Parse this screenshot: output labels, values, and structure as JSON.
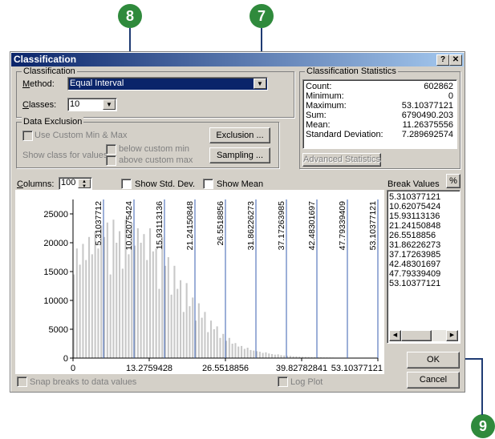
{
  "callouts": {
    "c7": "7",
    "c8": "8",
    "c9": "9"
  },
  "title": "Classification",
  "title_buttons": {
    "help": "?",
    "close": "✕"
  },
  "classification_group": {
    "label": "Classification",
    "method_label": "Method:",
    "method_value": "Equal Interval",
    "classes_label": "Classes:",
    "classes_value": "10"
  },
  "data_exclusion": {
    "label": "Data Exclusion",
    "use_custom": "Use Custom Min & Max",
    "show_class_for": "Show class for values",
    "below_custom_min": "below custom min",
    "above_custom_max": "above custom max",
    "exclusion_button": "Exclusion ...",
    "sampling_button": "Sampling ..."
  },
  "statistics": {
    "label": "Classification Statistics",
    "rows": [
      {
        "name": "Count:",
        "value": "602862"
      },
      {
        "name": "Minimum:",
        "value": "0"
      },
      {
        "name": "Maximum:",
        "value": "53.10377121"
      },
      {
        "name": "Sum:",
        "value": "6790490.203"
      },
      {
        "name": "Mean:",
        "value": "11.26375556"
      },
      {
        "name": "Standard Deviation:",
        "value": "7.289692574"
      }
    ],
    "advanced_button": "Advanced Statistics"
  },
  "histogram_controls": {
    "columns_label": "Columns:",
    "columns_value": "100",
    "show_std_dev": "Show Std. Dev.",
    "show_mean": "Show Mean"
  },
  "chart_data": {
    "type": "bar",
    "ylim": [
      0,
      27500
    ],
    "xlim": [
      0,
      53.10377121
    ],
    "y_ticks": [
      "25000",
      "20000",
      "15000",
      "10000",
      "5000",
      "0"
    ],
    "y_tick_values": [
      25000,
      20000,
      15000,
      10000,
      5000,
      0
    ],
    "x_tick_labels": [
      "0",
      "13.2759428",
      "26.5518856",
      "39.82782841",
      "53.10377121"
    ],
    "x_tick_values": [
      0,
      13.2759428,
      26.5518856,
      39.82782841,
      53.10377121
    ],
    "break_values": [
      5.310377121,
      10.62075424,
      15.93113136,
      21.24150848,
      26.5518856,
      31.86226273,
      37.17263985,
      42.48301697,
      47.79339409,
      53.10377121
    ],
    "break_labels": [
      "5.31037712",
      "10.62075424",
      "15.93113136",
      "21.24150848",
      "26.5518856",
      "31.86226273",
      "37.17263985",
      "42.48301697",
      "47.79339409",
      "53.10377121"
    ],
    "values": [
      14500,
      19000,
      16200,
      19800,
      17000,
      21000,
      18000,
      22000,
      19000,
      23000,
      21000,
      23500,
      14500,
      24000,
      20000,
      22000,
      15500,
      24000,
      18000,
      23500,
      19500,
      22500,
      20000,
      21500,
      17000,
      22500,
      18500,
      19000,
      12000,
      21000,
      16000,
      17500,
      11000,
      16000,
      12000,
      13500,
      8000,
      13000,
      9000,
      10500,
      6500,
      9500,
      7000,
      8000,
      4500,
      6500,
      5000,
      5500,
      3500,
      4200,
      3000,
      3500,
      2500,
      2600,
      2000,
      2100,
      1600,
      1800,
      1400,
      1300,
      1200,
      1100,
      900,
      1000,
      800,
      700,
      600,
      650,
      500,
      450,
      400,
      380,
      300,
      300,
      250,
      220,
      200,
      190,
      160,
      150,
      130,
      120,
      100,
      100,
      90,
      80,
      70,
      60,
      50,
      50,
      40,
      40,
      30,
      30,
      25,
      20,
      18,
      15,
      10,
      8
    ]
  },
  "break_panel": {
    "label": "Break Values",
    "percent_button": "%",
    "values": [
      "5.310377121",
      "10.62075424",
      "15.93113136",
      "21.24150848",
      "26.5518856",
      "31.86226273",
      "37.17263985",
      "42.48301697",
      "47.79339409",
      "53.10377121"
    ]
  },
  "buttons": {
    "ok": "OK",
    "cancel": "Cancel"
  },
  "bottom": {
    "snap_breaks": "Snap breaks to data values",
    "log_plot": "Log Plot"
  }
}
